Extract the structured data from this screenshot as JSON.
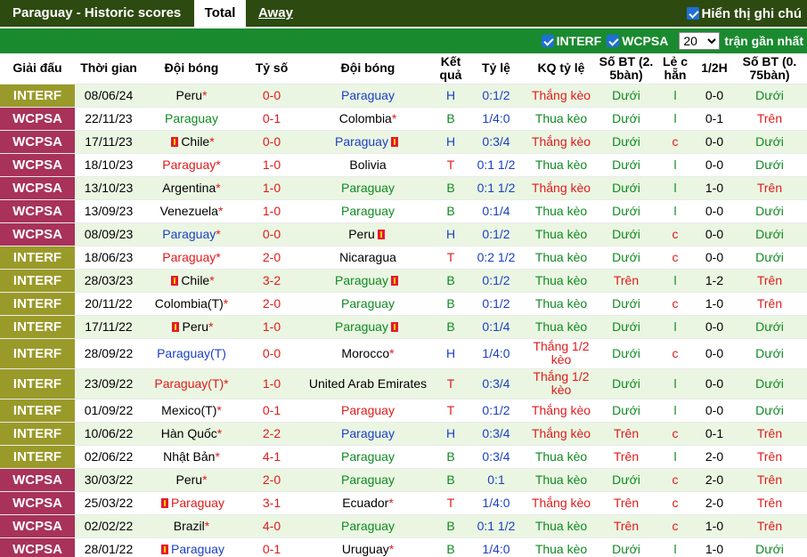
{
  "header": {
    "title": "Paraguay - Historic scores",
    "tab_total": "Total",
    "tab_away": "Away",
    "toggle_label": "Hiển thị ghi chú"
  },
  "filters": {
    "interf": "INTERF",
    "wcpsa": "WCPSA",
    "count": "20",
    "suffix": "trận gần nhất"
  },
  "columns": [
    "Giải đấu",
    "Thời gian",
    "Đội bóng",
    "Tỷ số",
    "Đội bóng",
    "Kết quả",
    "Tỷ lệ",
    "KQ tỷ lệ",
    "Số BT (2.5bàn)",
    "Lẻ chẵn",
    "1/2H",
    "Số BT (0.75bàn)"
  ],
  "column_lines": {
    "ket": [
      "Kết",
      "quả"
    ],
    "sobt25": [
      "Số BT (2.",
      "5bàn)"
    ],
    "lechan": [
      "Lẻ c",
      "hẵn"
    ],
    "sobt075": [
      "Số BT (0.",
      "75bàn)"
    ]
  },
  "colors": {
    "interf": "#9a9a2a",
    "wcpsa": "#a8325a",
    "header_bar": "#2d4a10",
    "filter_bar": "#1a8a2f"
  },
  "rows": [
    {
      "comp": "INTERF",
      "date": "08/06/24",
      "home": "Peru",
      "home_star": true,
      "home_card": false,
      "home_color": "black",
      "score": "0-0",
      "away": "Paraguay",
      "away_star": false,
      "away_card": false,
      "away_color": "blue",
      "result": "H",
      "odds": "0:1/2",
      "kq": "Thắng kèo",
      "bt25": "Dưới",
      "lc": "l",
      "half": "0-0",
      "bt075": "Dưới"
    },
    {
      "comp": "WCPSA",
      "date": "22/11/23",
      "home": "Paraguay",
      "home_star": false,
      "home_card": false,
      "home_color": "green",
      "score": "0-1",
      "away": "Colombia",
      "away_star": true,
      "away_card": false,
      "away_color": "black",
      "result": "B",
      "odds": "1/4:0",
      "kq": "Thua kèo",
      "bt25": "Dưới",
      "lc": "l",
      "half": "0-1",
      "bt075": "Trên"
    },
    {
      "comp": "WCPSA",
      "date": "17/11/23",
      "home": "Chile",
      "home_star": true,
      "home_card": true,
      "home_color": "black",
      "score": "0-0",
      "away": "Paraguay",
      "away_star": false,
      "away_card": true,
      "away_color": "blue",
      "result": "H",
      "odds": "0:3/4",
      "kq": "Thắng kèo",
      "bt25": "Dưới",
      "lc": "c",
      "half": "0-0",
      "bt075": "Dưới"
    },
    {
      "comp": "WCPSA",
      "date": "18/10/23",
      "home": "Paraguay",
      "home_star": true,
      "home_card": false,
      "home_color": "red",
      "score": "1-0",
      "away": "Bolivia",
      "away_star": false,
      "away_card": false,
      "away_color": "black",
      "result": "T",
      "odds": "0:1 1/2",
      "kq": "Thua kèo",
      "bt25": "Dưới",
      "lc": "l",
      "half": "0-0",
      "bt075": "Dưới"
    },
    {
      "comp": "WCPSA",
      "date": "13/10/23",
      "home": "Argentina",
      "home_star": true,
      "home_card": false,
      "home_color": "black",
      "score": "1-0",
      "away": "Paraguay",
      "away_star": false,
      "away_card": false,
      "away_color": "green",
      "result": "B",
      "odds": "0:1 1/2",
      "kq": "Thắng kèo",
      "bt25": "Dưới",
      "lc": "l",
      "half": "1-0",
      "bt075": "Trên"
    },
    {
      "comp": "WCPSA",
      "date": "13/09/23",
      "home": "Venezuela",
      "home_star": true,
      "home_card": false,
      "home_color": "black",
      "score": "1-0",
      "away": "Paraguay",
      "away_star": false,
      "away_card": false,
      "away_color": "green",
      "result": "B",
      "odds": "0:1/4",
      "kq": "Thua kèo",
      "bt25": "Dưới",
      "lc": "l",
      "half": "0-0",
      "bt075": "Dưới"
    },
    {
      "comp": "WCPSA",
      "date": "08/09/23",
      "home": "Paraguay",
      "home_star": true,
      "home_card": false,
      "home_color": "blue",
      "score": "0-0",
      "away": "Peru",
      "away_star": false,
      "away_card": true,
      "away_color": "black",
      "result": "H",
      "odds": "0:1/2",
      "kq": "Thua kèo",
      "bt25": "Dưới",
      "lc": "c",
      "half": "0-0",
      "bt075": "Dưới"
    },
    {
      "comp": "INTERF",
      "date": "18/06/23",
      "home": "Paraguay",
      "home_star": true,
      "home_card": false,
      "home_color": "red",
      "score": "2-0",
      "away": "Nicaragua",
      "away_star": false,
      "away_card": false,
      "away_color": "black",
      "result": "T",
      "odds": "0:2 1/2",
      "kq": "Thua kèo",
      "bt25": "Dưới",
      "lc": "c",
      "half": "0-0",
      "bt075": "Dưới"
    },
    {
      "comp": "INTERF",
      "date": "28/03/23",
      "home": "Chile",
      "home_star": true,
      "home_card": true,
      "home_color": "black",
      "score": "3-2",
      "away": "Paraguay",
      "away_star": false,
      "away_card": true,
      "away_color": "green",
      "result": "B",
      "odds": "0:1/2",
      "kq": "Thua kèo",
      "bt25": "Trên",
      "lc": "l",
      "half": "1-2",
      "bt075": "Trên"
    },
    {
      "comp": "INTERF",
      "date": "20/11/22",
      "home": "Colombia(T)",
      "home_star": true,
      "home_card": false,
      "home_color": "black",
      "score": "2-0",
      "away": "Paraguay",
      "away_star": false,
      "away_card": false,
      "away_color": "green",
      "result": "B",
      "odds": "0:1/2",
      "kq": "Thua kèo",
      "bt25": "Dưới",
      "lc": "c",
      "half": "1-0",
      "bt075": "Trên"
    },
    {
      "comp": "INTERF",
      "date": "17/11/22",
      "home": "Peru",
      "home_star": true,
      "home_card": true,
      "home_color": "black",
      "score": "1-0",
      "away": "Paraguay",
      "away_star": false,
      "away_card": true,
      "away_color": "green",
      "result": "B",
      "odds": "0:1/4",
      "kq": "Thua kèo",
      "bt25": "Dưới",
      "lc": "l",
      "half": "0-0",
      "bt075": "Dưới"
    },
    {
      "comp": "INTERF",
      "date": "28/09/22",
      "home": "Paraguay(T)",
      "home_star": false,
      "home_card": false,
      "home_color": "blue",
      "score": "0-0",
      "away": "Morocco",
      "away_star": true,
      "away_card": false,
      "away_color": "black",
      "result": "H",
      "odds": "1/4:0",
      "kq": "Thắng 1/2 kèo",
      "bt25": "Dưới",
      "lc": "c",
      "half": "0-0",
      "bt075": "Dưới",
      "tall": true
    },
    {
      "comp": "INTERF",
      "date": "23/09/22",
      "home": "Paraguay(T)",
      "home_star": true,
      "home_card": false,
      "home_color": "red",
      "score": "1-0",
      "away": "United Arab Emirates",
      "away_star": false,
      "away_card": false,
      "away_color": "black",
      "result": "T",
      "odds": "0:3/4",
      "kq": "Thắng 1/2 kèo",
      "bt25": "Dưới",
      "lc": "l",
      "half": "0-0",
      "bt075": "Dưới",
      "tall": true
    },
    {
      "comp": "INTERF",
      "date": "01/09/22",
      "home": "Mexico(T)",
      "home_star": true,
      "home_card": false,
      "home_color": "black",
      "score": "0-1",
      "away": "Paraguay",
      "away_star": false,
      "away_card": false,
      "away_color": "red",
      "result": "T",
      "odds": "0:1/2",
      "kq": "Thắng kèo",
      "bt25": "Dưới",
      "lc": "l",
      "half": "0-0",
      "bt075": "Dưới"
    },
    {
      "comp": "INTERF",
      "date": "10/06/22",
      "home": "Hàn Quốc",
      "home_star": true,
      "home_card": false,
      "home_color": "black",
      "score": "2-2",
      "away": "Paraguay",
      "away_star": false,
      "away_card": false,
      "away_color": "blue",
      "result": "H",
      "odds": "0:3/4",
      "kq": "Thắng kèo",
      "bt25": "Trên",
      "lc": "c",
      "half": "0-1",
      "bt075": "Trên"
    },
    {
      "comp": "INTERF",
      "date": "02/06/22",
      "home": "Nhật Bản",
      "home_star": true,
      "home_card": false,
      "home_color": "black",
      "score": "4-1",
      "away": "Paraguay",
      "away_star": false,
      "away_card": false,
      "away_color": "green",
      "result": "B",
      "odds": "0:3/4",
      "kq": "Thua kèo",
      "bt25": "Trên",
      "lc": "l",
      "half": "2-0",
      "bt075": "Trên"
    },
    {
      "comp": "WCPSA",
      "date": "30/03/22",
      "home": "Peru",
      "home_star": true,
      "home_card": false,
      "home_color": "black",
      "score": "2-0",
      "away": "Paraguay",
      "away_star": false,
      "away_card": false,
      "away_color": "green",
      "result": "B",
      "odds": "0:1",
      "kq": "Thua kèo",
      "bt25": "Dưới",
      "lc": "c",
      "half": "2-0",
      "bt075": "Trên"
    },
    {
      "comp": "WCPSA",
      "date": "25/03/22",
      "home": "Paraguay",
      "home_star": false,
      "home_card": true,
      "home_color": "red",
      "score": "3-1",
      "away": "Ecuador",
      "away_star": true,
      "away_card": false,
      "away_color": "black",
      "result": "T",
      "odds": "1/4:0",
      "kq": "Thắng kèo",
      "bt25": "Trên",
      "lc": "c",
      "half": "2-0",
      "bt075": "Trên"
    },
    {
      "comp": "WCPSA",
      "date": "02/02/22",
      "home": "Brazil",
      "home_star": true,
      "home_card": false,
      "home_color": "black",
      "score": "4-0",
      "away": "Paraguay",
      "away_star": false,
      "away_card": false,
      "away_color": "green",
      "result": "B",
      "odds": "0:1 1/2",
      "kq": "Thua kèo",
      "bt25": "Trên",
      "lc": "c",
      "half": "1-0",
      "bt075": "Trên"
    },
    {
      "comp": "WCPSA",
      "date": "28/01/22",
      "home": "Paraguay",
      "home_star": false,
      "home_card": true,
      "home_color": "blue",
      "score": "0-1",
      "away": "Uruguay",
      "away_star": true,
      "away_card": false,
      "away_color": "black",
      "result": "B",
      "odds": "1/4:0",
      "kq": "Thua kèo",
      "bt25": "Dưới",
      "lc": "l",
      "half": "1-0",
      "bt075": "Dưới"
    }
  ]
}
